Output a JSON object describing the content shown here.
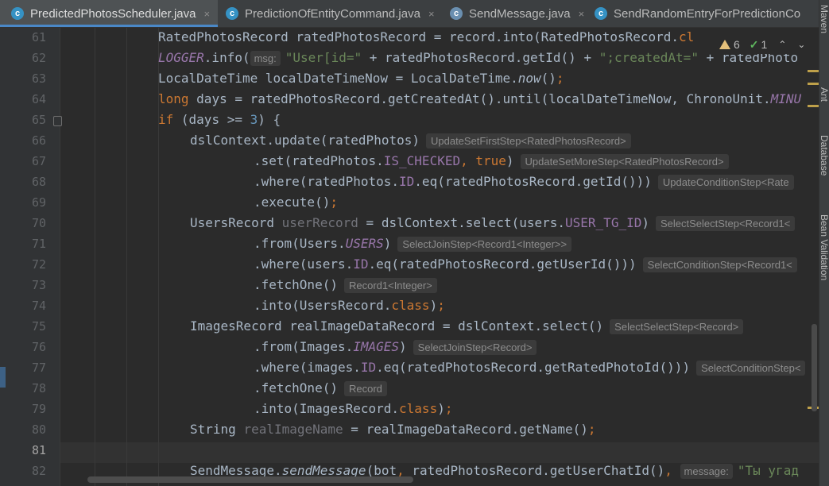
{
  "tabs": [
    {
      "label": "PredictedPhotosScheduler.java",
      "icon": "java-class-icon",
      "active": true,
      "close": "×"
    },
    {
      "label": "PredictionOfEntityCommand.java",
      "icon": "java-class-icon",
      "active": false,
      "close": "×"
    },
    {
      "label": "SendMessage.java",
      "icon": "java-class-icon",
      "active": false,
      "close": "×"
    },
    {
      "label": "SendRandomEntryForPredictionCo",
      "icon": "java-class-icon",
      "active": false,
      "close": ""
    }
  ],
  "inspection": {
    "warnings": "6",
    "checks": "1",
    "prev": "⌃",
    "next": "⌄"
  },
  "right_strip_labels": [
    "Maven",
    "Ant",
    "Database",
    "Bean Validation"
  ],
  "editor": {
    "current_line": "81",
    "lines": [
      {
        "num": "61",
        "tokens": [
          {
            "t": "RatedPhotosRecord ratedPhotosRecord = record.into(RatedPhotosRecord.",
            "c": ""
          },
          {
            "t": "cl",
            "c": "kw"
          }
        ]
      },
      {
        "num": "62",
        "tokens": [
          {
            "t": "LOGGER",
            "c": "fld ital"
          },
          {
            "t": ".info(",
            "c": ""
          },
          {
            "t": "msg:",
            "c": "phint"
          },
          {
            "t": "\"User[id=\"",
            "c": "str"
          },
          {
            "t": " + ratedPhotosRecord.getId() + ",
            "c": ""
          },
          {
            "t": "\";createdAt=\"",
            "c": "str"
          },
          {
            "t": " + ratedPhoto",
            "c": ""
          }
        ]
      },
      {
        "num": "63",
        "tokens": [
          {
            "t": "LocalDateTime localDateTimeNow = LocalDateTime.",
            "c": ""
          },
          {
            "t": "now",
            "c": "ital"
          },
          {
            "t": "()",
            "c": ""
          },
          {
            "t": ";",
            "c": "kw"
          }
        ]
      },
      {
        "num": "64",
        "tokens": [
          {
            "t": "long ",
            "c": "kw"
          },
          {
            "t": "days = ratedPhotosRecord.getCreatedAt().until(localDateTimeNow, ChronoUnit.",
            "c": ""
          },
          {
            "t": "MINU",
            "c": "fld ital"
          }
        ]
      },
      {
        "num": "65",
        "tokens": [
          {
            "t": "if ",
            "c": "kw"
          },
          {
            "t": "(days >= ",
            "c": ""
          },
          {
            "t": "3",
            "c": "num"
          },
          {
            "t": ") {",
            "c": ""
          }
        ]
      },
      {
        "num": "66",
        "tokens": [
          {
            "t": "dslContext.update(ratedPhotos)",
            "c": ""
          },
          {
            "t": "UpdateSetFirstStep<RatedPhotosRecord>",
            "c": "hint"
          }
        ]
      },
      {
        "num": "67",
        "tokens": [
          {
            "t": ".set(ratedPhotos.",
            "c": ""
          },
          {
            "t": "IS_CHECKED",
            "c": "fld"
          },
          {
            "t": ", ",
            "c": "kw"
          },
          {
            "t": "true",
            "c": "kw"
          },
          {
            "t": ")",
            "c": ""
          },
          {
            "t": "UpdateSetMoreStep<RatedPhotosRecord>",
            "c": "hint"
          }
        ]
      },
      {
        "num": "68",
        "tokens": [
          {
            "t": ".where(ratedPhotos.",
            "c": ""
          },
          {
            "t": "ID",
            "c": "fld"
          },
          {
            "t": ".eq(ratedPhotosRecord.getId()))",
            "c": ""
          },
          {
            "t": "UpdateConditionStep<Rate",
            "c": "hint"
          }
        ]
      },
      {
        "num": "69",
        "tokens": [
          {
            "t": ".execute()",
            "c": ""
          },
          {
            "t": ";",
            "c": "kw"
          }
        ]
      },
      {
        "num": "70",
        "tokens": [
          {
            "t": "UsersRecord ",
            "c": ""
          },
          {
            "t": "userRecord",
            "c": "unused"
          },
          {
            "t": " = dslContext.select(users.",
            "c": ""
          },
          {
            "t": "USER_TG_ID",
            "c": "fld"
          },
          {
            "t": ")",
            "c": ""
          },
          {
            "t": "SelectSelectStep<Record1<",
            "c": "hint"
          }
        ]
      },
      {
        "num": "71",
        "tokens": [
          {
            "t": ".from(Users.",
            "c": ""
          },
          {
            "t": "USERS",
            "c": "fld ital"
          },
          {
            "t": ")",
            "c": ""
          },
          {
            "t": "SelectJoinStep<Record1<Integer>>",
            "c": "hint"
          }
        ]
      },
      {
        "num": "72",
        "tokens": [
          {
            "t": ".where(users.",
            "c": ""
          },
          {
            "t": "ID",
            "c": "fld"
          },
          {
            "t": ".eq(ratedPhotosRecord.getUserId()))",
            "c": ""
          },
          {
            "t": "SelectConditionStep<Record1<",
            "c": "hint"
          }
        ]
      },
      {
        "num": "73",
        "tokens": [
          {
            "t": ".fetchOne()",
            "c": ""
          },
          {
            "t": "Record1<Integer>",
            "c": "hint"
          }
        ]
      },
      {
        "num": "74",
        "tokens": [
          {
            "t": ".into(UsersRecord.",
            "c": ""
          },
          {
            "t": "class",
            "c": "kw"
          },
          {
            "t": ")",
            "c": ""
          },
          {
            "t": ";",
            "c": "kw"
          }
        ]
      },
      {
        "num": "75",
        "tokens": [
          {
            "t": "ImagesRecord realImageDataRecord = dslContext.select()",
            "c": ""
          },
          {
            "t": "SelectSelectStep<Record>",
            "c": "hint"
          }
        ]
      },
      {
        "num": "76",
        "tokens": [
          {
            "t": ".from(Images.",
            "c": ""
          },
          {
            "t": "IMAGES",
            "c": "fld ital"
          },
          {
            "t": ")",
            "c": ""
          },
          {
            "t": "SelectJoinStep<Record>",
            "c": "hint"
          }
        ]
      },
      {
        "num": "77",
        "tokens": [
          {
            "t": ".where(images.",
            "c": ""
          },
          {
            "t": "ID",
            "c": "fld"
          },
          {
            "t": ".eq(ratedPhotosRecord.getRatedPhotoId()))",
            "c": ""
          },
          {
            "t": "SelectConditionStep<",
            "c": "hint"
          }
        ]
      },
      {
        "num": "78",
        "tokens": [
          {
            "t": ".fetchOne()",
            "c": ""
          },
          {
            "t": "Record",
            "c": "hint"
          }
        ]
      },
      {
        "num": "79",
        "tokens": [
          {
            "t": ".into(ImagesRecord.",
            "c": ""
          },
          {
            "t": "class",
            "c": "kw"
          },
          {
            "t": ")",
            "c": ""
          },
          {
            "t": ";",
            "c": "kw"
          }
        ]
      },
      {
        "num": "80",
        "tokens": [
          {
            "t": "String ",
            "c": ""
          },
          {
            "t": "realImageName",
            "c": "unused"
          },
          {
            "t": " = realImageDataRecord.getName()",
            "c": ""
          },
          {
            "t": ";",
            "c": "kw"
          }
        ]
      },
      {
        "num": "81",
        "tokens": []
      },
      {
        "num": "82",
        "tokens": [
          {
            "t": "SendMessage.",
            "c": ""
          },
          {
            "t": "sendMessage",
            "c": "ital"
          },
          {
            "t": "(bot",
            "c": ""
          },
          {
            "t": ", ",
            "c": "kw"
          },
          {
            "t": "ratedPhotosRecord.getUserChatId()",
            "c": ""
          },
          {
            "t": ", ",
            "c": "kw"
          },
          {
            "t": "message:",
            "c": "phint"
          },
          {
            "t": "\"Ты угад",
            "c": "str"
          }
        ]
      }
    ]
  },
  "colors": {
    "background": "#2b2b2b",
    "keyword": "#cc7832",
    "field": "#9876aa",
    "string": "#6a8759",
    "number": "#6897bb",
    "text": "#a9b7c6",
    "accent": "#4a88c7",
    "warning": "#e5c07b"
  }
}
